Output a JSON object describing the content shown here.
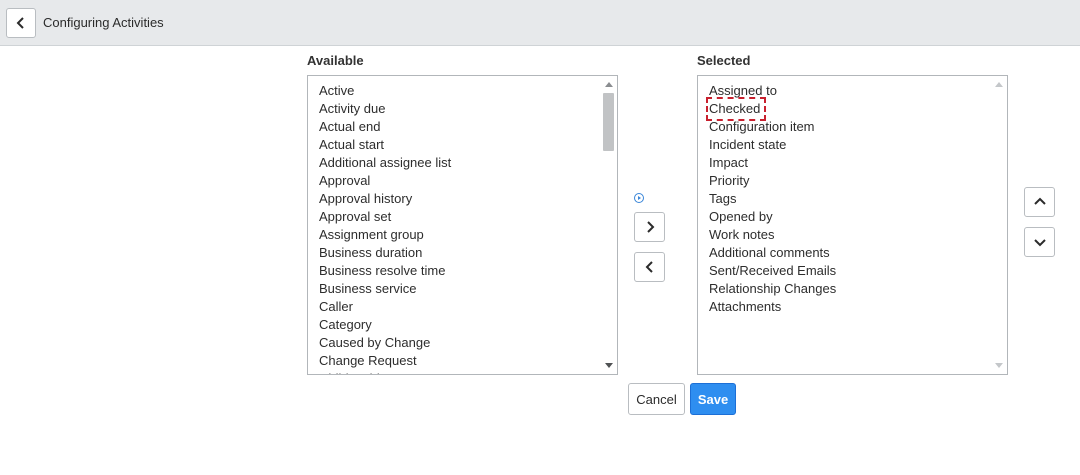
{
  "header": {
    "title": "Configuring Activities",
    "back_icon": "chevron-left-icon"
  },
  "available": {
    "label": "Available",
    "items": [
      "Active",
      "Activity due",
      "Actual end",
      "Actual start",
      "Additional assignee list",
      "Approval",
      "Approval history",
      "Approval set",
      "Assignment group",
      "Business duration",
      "Business resolve time",
      "Business service",
      "Caller",
      "Category",
      "Caused by Change",
      "Change Request",
      "Child Incidents"
    ]
  },
  "selected": {
    "label": "Selected",
    "items": [
      "Assigned to",
      "Checked",
      "Configuration item",
      "Incident state",
      "Impact",
      "Priority",
      "Tags",
      "Opened by",
      "Work notes",
      "Additional comments",
      "Sent/Received Emails",
      "Relationship Changes",
      "Attachments"
    ],
    "highlighted_item": "Checked",
    "highlight_color": "#c8202e"
  },
  "transfer": {
    "add_icon": "chevron-right-icon",
    "remove_icon": "chevron-left-icon",
    "info_icon": "play-circle-icon"
  },
  "order": {
    "up_icon": "chevron-up-icon",
    "down_icon": "chevron-down-icon"
  },
  "actions": {
    "cancel_label": "Cancel",
    "save_label": "Save",
    "save_color": "#2e8ef0"
  }
}
